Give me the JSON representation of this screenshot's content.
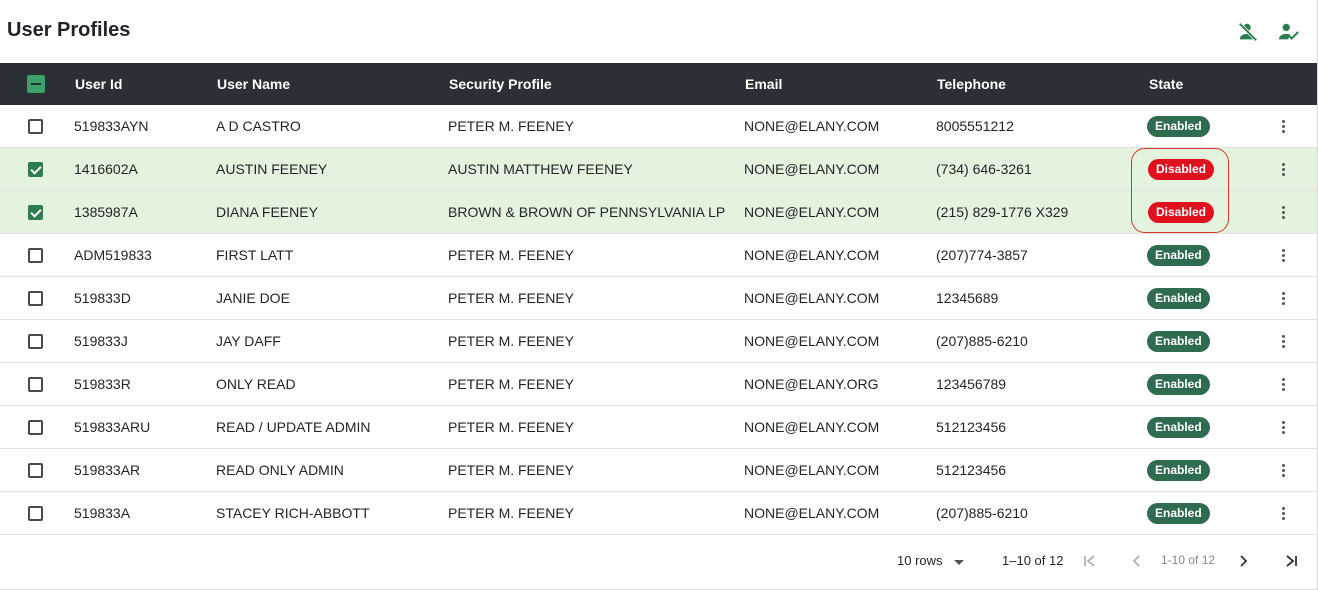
{
  "header": {
    "title": "User Profiles",
    "actions": [
      {
        "icon": "person-off-icon",
        "color": "#2e7d4f"
      },
      {
        "icon": "person-check-icon",
        "color": "#2e7d4f"
      }
    ]
  },
  "table": {
    "columns": [
      "User Id",
      "User Name",
      "Security Profile",
      "Email",
      "Telephone",
      "State"
    ],
    "rows": [
      {
        "id": "519833AYN",
        "name": "A D CASTRO",
        "security": "PETER M. FEENEY",
        "email": "NONE@ELANY.COM",
        "tel": "8005551212",
        "state": "Enabled",
        "selected": false
      },
      {
        "id": "1416602A",
        "name": "AUSTIN FEENEY",
        "security": "AUSTIN MATTHEW FEENEY",
        "email": "NONE@ELANY.COM",
        "tel": "(734) 646-3261",
        "state": "Disabled",
        "selected": true
      },
      {
        "id": "1385987A",
        "name": "DIANA FEENEY",
        "security": "BROWN & BROWN OF PENNSYLVANIA LP",
        "email": "NONE@ELANY.COM",
        "tel": "(215) 829-1776 X329",
        "state": "Disabled",
        "selected": true
      },
      {
        "id": "ADM519833",
        "name": "FIRST LATT",
        "security": "PETER M. FEENEY",
        "email": "NONE@ELANY.COM",
        "tel": "(207)774-3857",
        "state": "Enabled",
        "selected": false
      },
      {
        "id": "519833D",
        "name": "JANIE DOE",
        "security": "PETER M. FEENEY",
        "email": "NONE@ELANY.COM",
        "tel": "12345689",
        "state": "Enabled",
        "selected": false
      },
      {
        "id": "519833J",
        "name": "JAY DAFF",
        "security": "PETER M. FEENEY",
        "email": "NONE@ELANY.COM",
        "tel": "(207)885-6210",
        "state": "Enabled",
        "selected": false
      },
      {
        "id": "519833R",
        "name": "ONLY READ",
        "security": "PETER M. FEENEY",
        "email": "NONE@ELANY.ORG",
        "tel": "123456789",
        "state": "Enabled",
        "selected": false
      },
      {
        "id": "519833ARU",
        "name": "READ / UPDATE ADMIN",
        "security": "PETER M. FEENEY",
        "email": "NONE@ELANY.COM",
        "tel": "512123456",
        "state": "Enabled",
        "selected": false
      },
      {
        "id": "519833AR",
        "name": "READ ONLY ADMIN",
        "security": "PETER M. FEENEY",
        "email": "NONE@ELANY.COM",
        "tel": "512123456",
        "state": "Enabled",
        "selected": false
      },
      {
        "id": "519833A",
        "name": "STACEY RICH-ABBOTT",
        "security": "PETER M. FEENEY",
        "email": "NONE@ELANY.COM",
        "tel": "(207)885-6210",
        "state": "Enabled",
        "selected": false
      }
    ]
  },
  "footer": {
    "rows_per_page": "10 rows",
    "range_label": "1–10 of 12",
    "page_label": "1-10 of 12"
  },
  "colors": {
    "enabled": "#2f6b4e",
    "disabled": "#e0111f",
    "header_bg": "#2b2f36",
    "selected_row": "#e3f3dd",
    "highlight": "#d6382b"
  }
}
